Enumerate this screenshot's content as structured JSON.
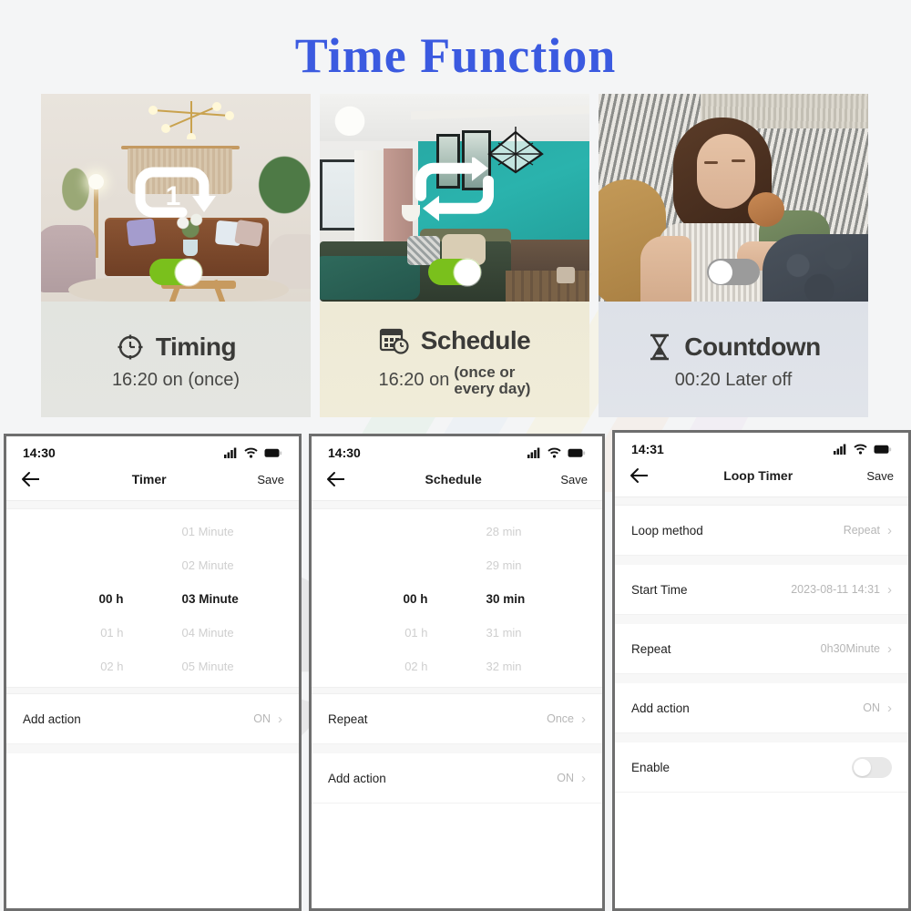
{
  "page": {
    "title": "Time Function",
    "title_color": "#3b5ae0",
    "background_color": "#f4f5f6"
  },
  "cards": [
    {
      "id": "timing",
      "icon": "clock-icon",
      "title": "Timing",
      "subtitle": "16:20 on (once)",
      "subtitle_lines": [],
      "overlay_icon": "repeat-once-icon",
      "toggle_state": "on",
      "toggle_color": "#7ac01c",
      "caption_bg": "#e3e5e0",
      "photo_alt": "warm beige living room with brown leather sofa"
    },
    {
      "id": "schedule",
      "icon": "calendar-clock-icon",
      "title": "Schedule",
      "subtitle": "16:20 on",
      "subtitle_lines": [
        "(once or",
        "every day)"
      ],
      "overlay_icon": "repeat-loop-icon",
      "toggle_state": "on",
      "toggle_color": "#7ac01c",
      "caption_bg": "#efebd7",
      "photo_alt": "teal bedroom with pendant lamps"
    },
    {
      "id": "countdown",
      "icon": "hourglass-icon",
      "title": "Countdown",
      "subtitle": "00:20 Later off",
      "subtitle_lines": [],
      "overlay_icon": "none",
      "toggle_state": "off",
      "toggle_color": "#9b9b9b",
      "caption_bg": "#dfe2e9",
      "photo_alt": "mother holding sleeping baby on a couch"
    }
  ],
  "phones": [
    {
      "id": "timer",
      "status": {
        "time": "14:30",
        "icons": [
          "signal-icon",
          "wifi-icon",
          "battery-icon"
        ]
      },
      "nav": {
        "back": "back-arrow-icon",
        "title": "Timer",
        "save": "Save"
      },
      "picker": {
        "rows": [
          {
            "hour": "",
            "minute": "01 Minute",
            "selected": false
          },
          {
            "hour": "",
            "minute": "02 Minute",
            "selected": false
          },
          {
            "hour": "00 h",
            "minute": "03 Minute",
            "selected": true
          },
          {
            "hour": "01 h",
            "minute": "04 Minute",
            "selected": false
          },
          {
            "hour": "02 h",
            "minute": "05 Minute",
            "selected": false
          }
        ]
      },
      "rows": [
        {
          "label": "Add action",
          "value": "ON",
          "chevron": true,
          "toggle": null
        }
      ]
    },
    {
      "id": "schedule",
      "status": {
        "time": "14:30",
        "icons": [
          "signal-icon",
          "wifi-icon",
          "battery-icon"
        ]
      },
      "nav": {
        "back": "back-arrow-icon",
        "title": "Schedule",
        "save": "Save"
      },
      "picker": {
        "rows": [
          {
            "hour": "",
            "minute": "28 min",
            "selected": false
          },
          {
            "hour": "",
            "minute": "29 min",
            "selected": false
          },
          {
            "hour": "00 h",
            "minute": "30 min",
            "selected": true
          },
          {
            "hour": "01 h",
            "minute": "31 min",
            "selected": false
          },
          {
            "hour": "02 h",
            "minute": "32 min",
            "selected": false
          }
        ]
      },
      "rows": [
        {
          "label": "Repeat",
          "value": "Once",
          "chevron": true,
          "toggle": null
        },
        {
          "label": "Add action",
          "value": "ON",
          "chevron": true,
          "toggle": null
        }
      ]
    },
    {
      "id": "loop-timer",
      "status": {
        "time": "14:31",
        "icons": [
          "signal-icon",
          "wifi-icon",
          "battery-icon"
        ]
      },
      "nav": {
        "back": "back-arrow-icon",
        "title": "Loop Timer",
        "save": "Save"
      },
      "picker": null,
      "rows": [
        {
          "label": "Loop method",
          "value": "Repeat",
          "chevron": true,
          "toggle": null
        },
        {
          "label": "Start Time",
          "value": "2023-08-11 14:31",
          "chevron": true,
          "toggle": null
        },
        {
          "label": "Repeat",
          "value": "0h30Minute",
          "chevron": true,
          "toggle": null
        },
        {
          "label": "Add action",
          "value": "ON",
          "chevron": true,
          "toggle": null
        },
        {
          "label": "Enable",
          "value": "",
          "chevron": false,
          "toggle": "off"
        }
      ]
    }
  ]
}
